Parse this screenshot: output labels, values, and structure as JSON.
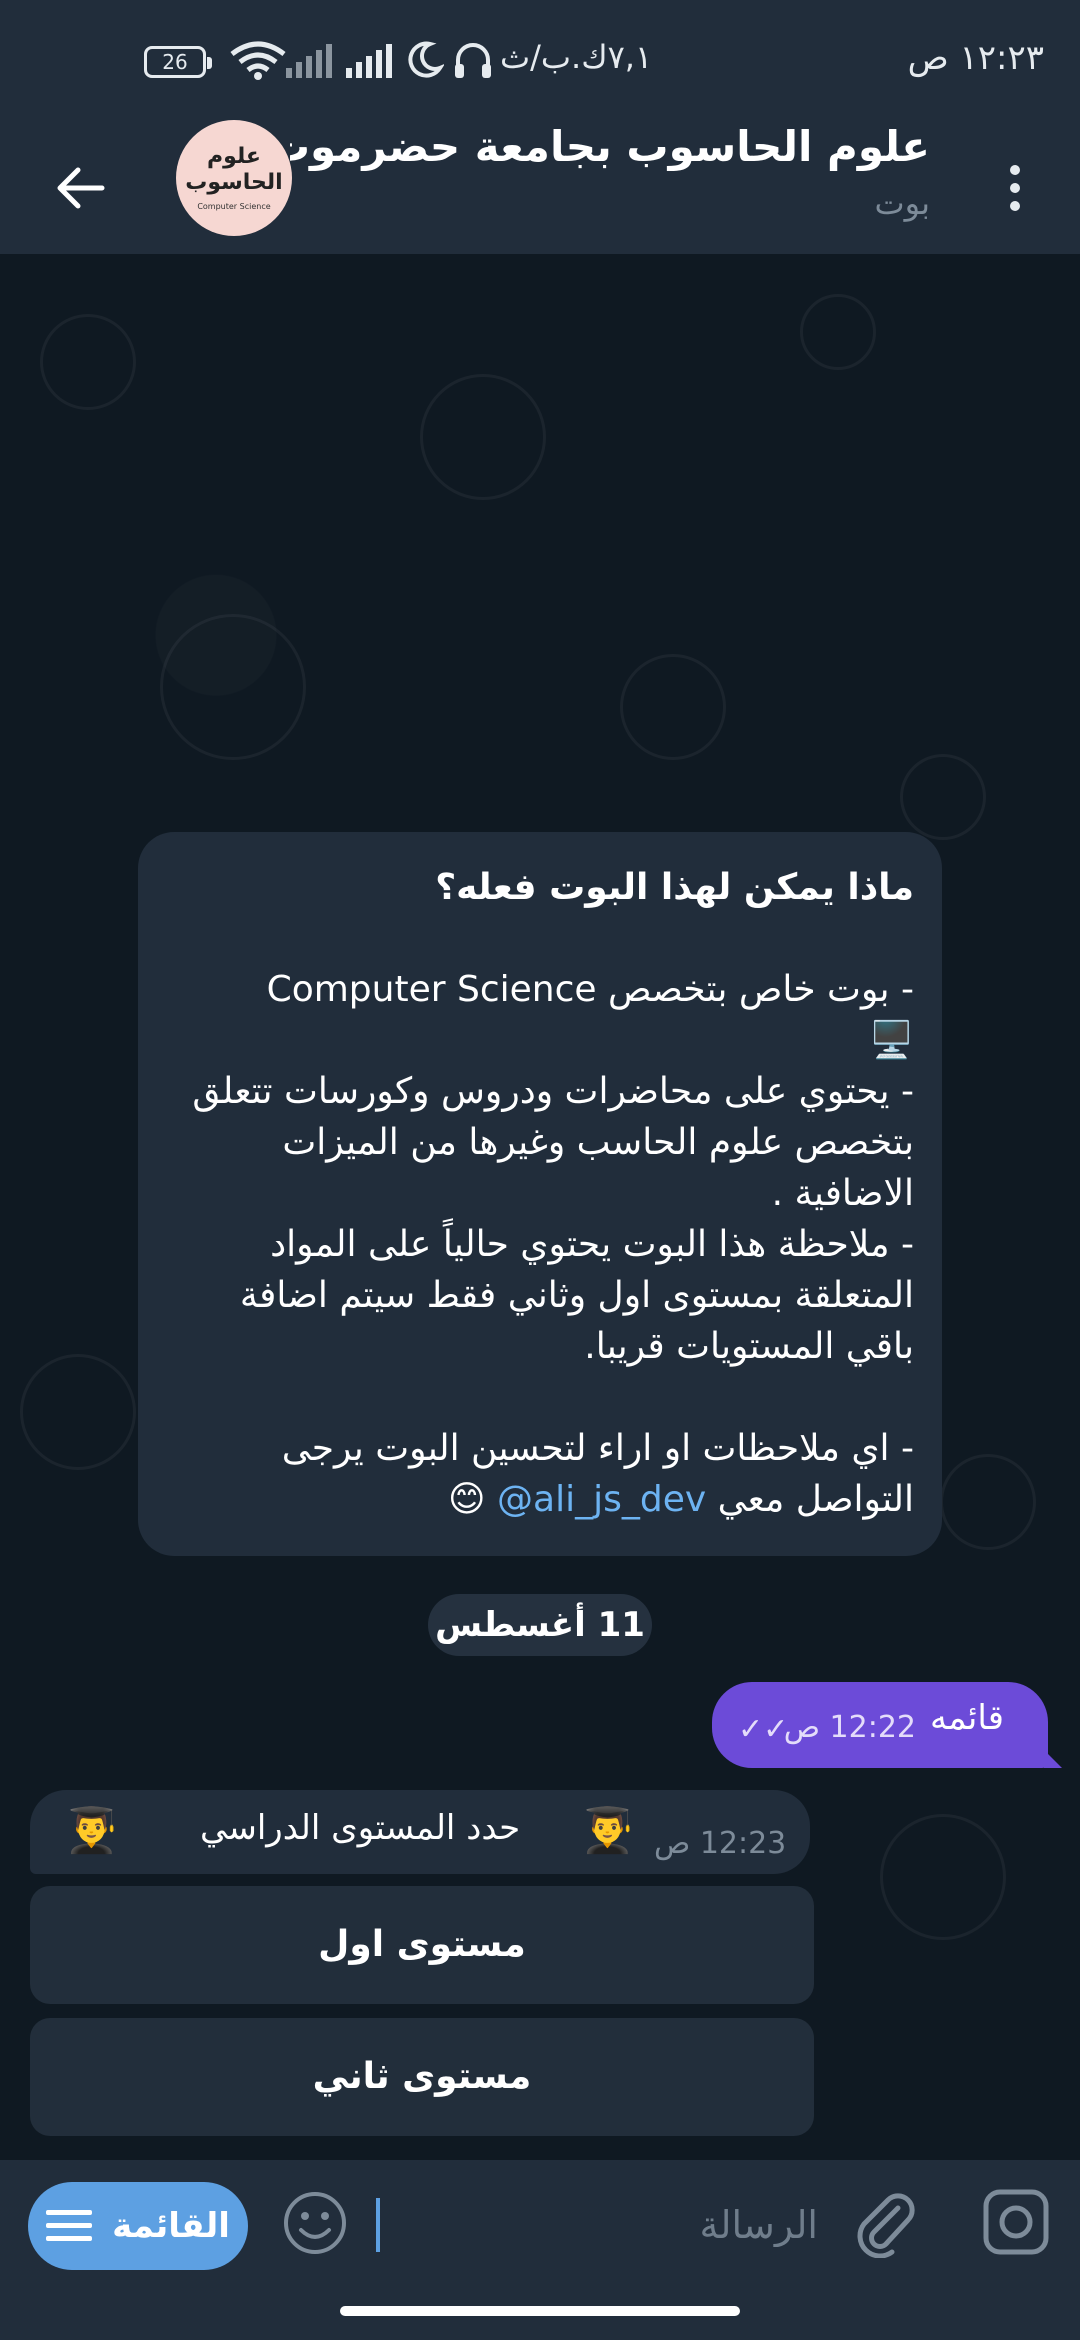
{
  "status_bar": {
    "time": "١٢:٢٣ ص",
    "carrier_text": "٧,١ك.ب/ث",
    "battery_level": "26"
  },
  "header": {
    "title": "علوم الحاسوب بجامعة حضرموت",
    "subtitle": "بوت",
    "avatar": {
      "line1": "علوم",
      "line2": "الحاسوب",
      "line3": "Computer Science"
    }
  },
  "bot_info": {
    "heading": "ماذا يمكن لهذا البوت فعله؟",
    "line1": "- بوت خاص بتخصص Computer Science",
    "emoji1": "🖥️",
    "line2": "- يحتوي على محاضرات ودروس وكورسات تتعلق بتخصص علوم الحاسب وغيرها من الميزات الاضافية .",
    "line3": "- ملاحظة هذا البوت يحتوي حالياً على المواد المتعلقة بمستوى اول وثاني فقط سيتم اضافة باقي المستويات قريبا.",
    "line4": "- اي ملاحظات او اراء لتحسين البوت يرجى التواصل معي",
    "mention": "@ali_js_dev",
    "emoji2": "😊"
  },
  "date_pill": "11 أغسطس",
  "outgoing": {
    "text": "قائمه",
    "time": "12:22 ص",
    "ticks": "✓✓"
  },
  "incoming": {
    "text": "حدد المستوى الدراسي",
    "emoji": "👨‍🎓",
    "time": "12:23 ص"
  },
  "keyboard": [
    {
      "label": "مستوى اول"
    },
    {
      "label": "مستوى ثاني"
    }
  ],
  "input_bar": {
    "menu_label": "القائمة",
    "placeholder": "الرسالة"
  },
  "colors": {
    "header_bg": "#212d3b",
    "chat_bg": "#0f1922",
    "outgoing_bubble": "#6c4bd8",
    "menu_button": "#5da0e2",
    "link": "#6db3f2"
  }
}
